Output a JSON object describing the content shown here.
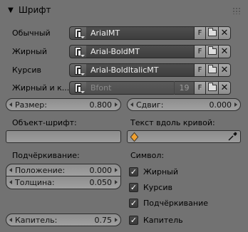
{
  "panel": {
    "title": "Шрифт",
    "collapse_icon": "triangle-down"
  },
  "fonts": [
    {
      "label": "Обычный",
      "name": "ArialMT",
      "key": "F",
      "enabled": true
    },
    {
      "label": "Жирный",
      "name": "Arial-BoldMT",
      "key": "F",
      "enabled": true
    },
    {
      "label": "Курсив",
      "name": "Arial-BoldItalicMT",
      "key": "F",
      "enabled": true
    },
    {
      "label": "Жирный и к...",
      "name": "Bfont",
      "users": "19",
      "key": "F",
      "enabled": false
    }
  ],
  "size": {
    "label": "Размер:",
    "value": "0.800"
  },
  "shear": {
    "label": "Сдвиг:",
    "value": "0.000"
  },
  "object_font": {
    "label": "Объект-шрифт:",
    "value": ""
  },
  "text_on_curve": {
    "label": "Текст вдоль кривой:",
    "value": ""
  },
  "underline": {
    "label": "Подчёркивание:",
    "position_label": "Положение:",
    "position_value": "0.000",
    "thickness_label": "Толщина:",
    "thickness_value": "0.050"
  },
  "small_caps": {
    "label": "Капитель:",
    "value": "0.75"
  },
  "symbol": {
    "label": "Символ:",
    "items": [
      {
        "label": "Жирный",
        "checked": true
      },
      {
        "label": "Курсив",
        "checked": true
      },
      {
        "label": "Подчёркивание",
        "checked": true
      },
      {
        "label": "Капитель",
        "checked": true
      }
    ]
  },
  "colors": {
    "background": "#727272",
    "field_dark": "#3e3e3e",
    "accent_orange": "#f0a030"
  }
}
